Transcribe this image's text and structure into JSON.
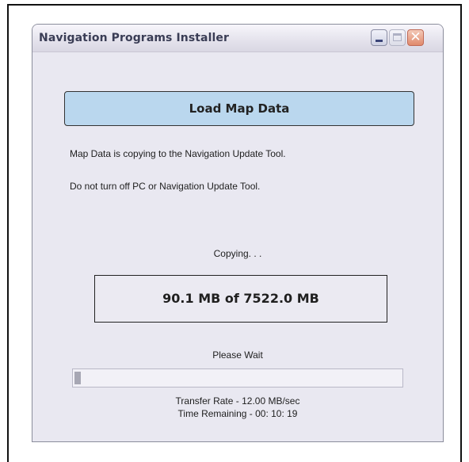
{
  "window": {
    "title": "Navigation Programs Installer",
    "controls": {
      "minimize_icon": "minimize-icon",
      "maximize_icon": "maximize-icon",
      "close_icon": "close-icon",
      "close_glyph": "✕"
    }
  },
  "header": {
    "label": "Load Map Data"
  },
  "messages": {
    "line1": "Map Data is copying to the Navigation Update Tool.",
    "line2": "Do not turn off PC or Navigation Update Tool."
  },
  "status": {
    "copying": "Copying. . .",
    "size": "90.1 MB of 7522.0 MB",
    "please_wait": "Please Wait",
    "progress_fraction": 0.012,
    "transfer_rate": "Transfer Rate - 12.00 MB/sec",
    "time_remaining": "Time Remaining - 00: 10: 19"
  },
  "colors": {
    "header_fill": "#bad7ee",
    "window_bg": "#e9e8f1",
    "progress_fill": "#a7a7b4",
    "close_button": "#e08a6c"
  }
}
